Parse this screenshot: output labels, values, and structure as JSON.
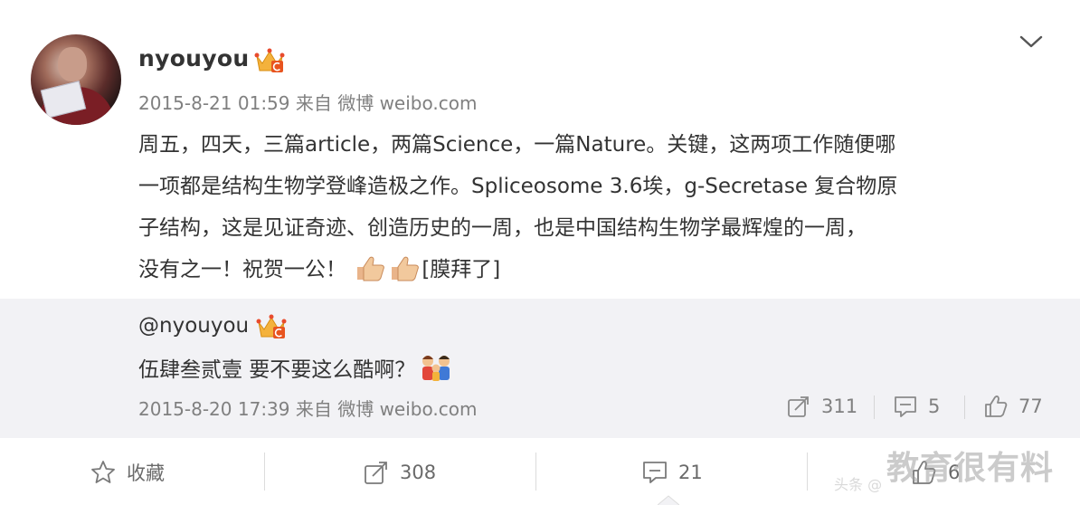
{
  "post": {
    "username": "nyouyou",
    "timestamp": "2015-8-21 01:59",
    "source": "来自 微博 weibo.com",
    "line1": "周五，四天，三篇article，两篇Science，一篇Nature。关键，这两项工作随便哪",
    "line2": "一项都是结构生物学登峰造极之作。Spliceosome 3.6埃，g-Secretase 复合物原",
    "line3": "子结构，这是见证奇迹、创造历史的一周，也是中国结构生物学最辉煌的一周，",
    "line4": "没有之一！祝贺一公！",
    "emoji_label": "[膜拜了]"
  },
  "repost": {
    "mention": "@nyouyou",
    "text": "伍肆叁贰壹 要不要这么酷啊？",
    "timestamp": "2015-8-20 17:39",
    "source": "来自 微博 weibo.com",
    "forward_count": "311",
    "comment_count": "5",
    "like_count": "77"
  },
  "actions": {
    "favorite_label": "收藏",
    "forward_count": "308",
    "comment_count": "21",
    "like_count": "6"
  },
  "watermark": {
    "main": "教育很有料",
    "sub": "头条 @"
  },
  "icons": {
    "vip_crown": "crown-icon",
    "expand": "chevron-down-icon",
    "forward": "share-icon",
    "comment": "comment-icon",
    "like": "thumbs-up-icon",
    "favorite": "star-icon"
  },
  "colors": {
    "text": "#333333",
    "meta": "#808080",
    "repost_bg": "#f2f2f5",
    "crown": "#f4b23c",
    "crown_badge": "#e8541f"
  }
}
